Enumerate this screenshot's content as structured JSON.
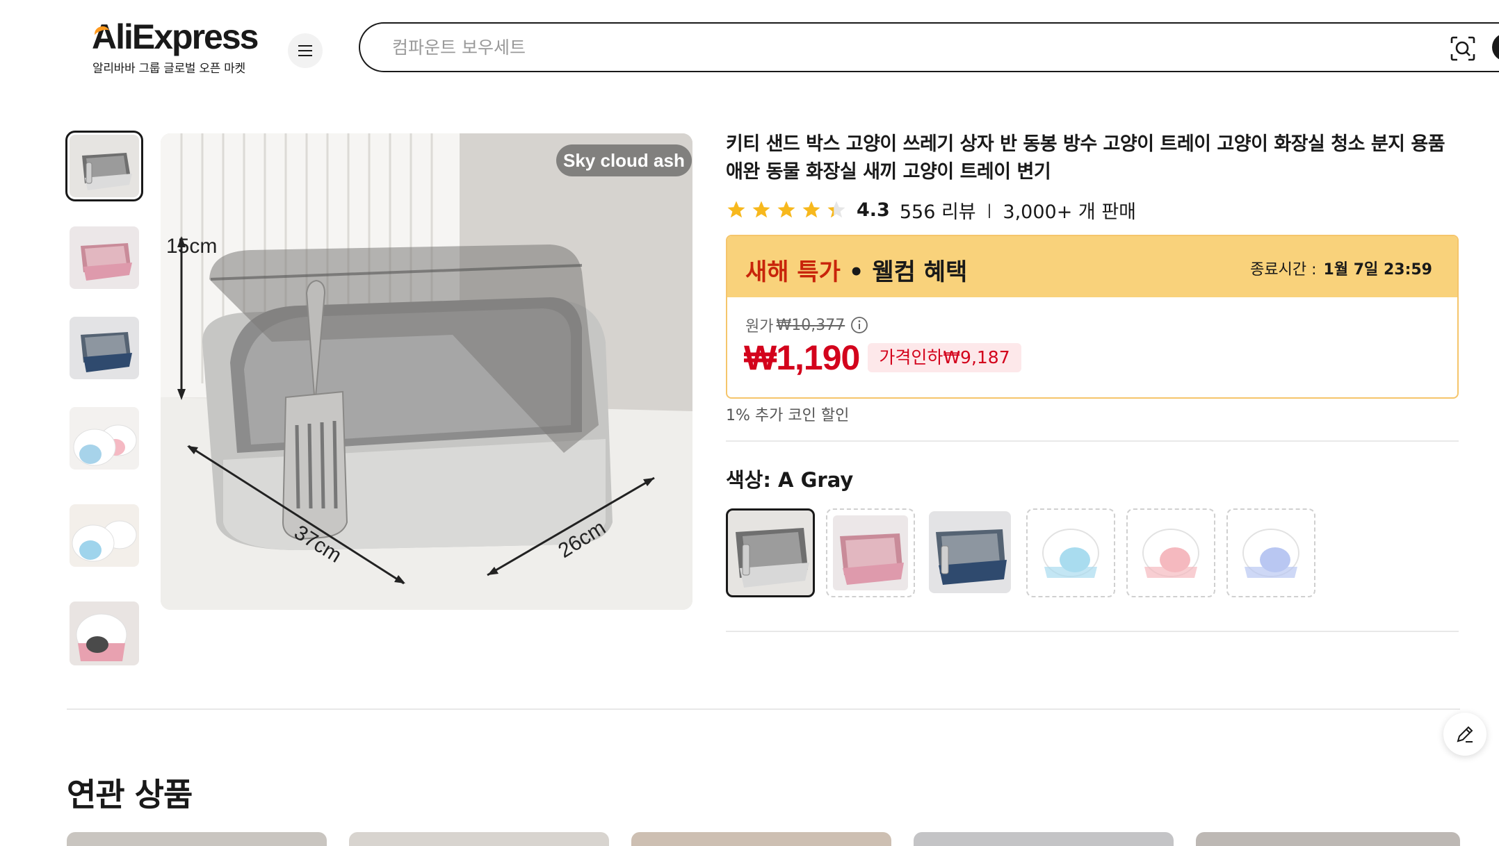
{
  "header": {
    "logo_text": "AliExpress",
    "logo_subtitle": "알리바바 그룹 글로벌 오픈 마켓",
    "search_placeholder": "컴파운트 보우세트"
  },
  "gallery": {
    "variant_tag": "Sky cloud ash",
    "dimension_labels": {
      "height": "15cm",
      "length": "37cm",
      "width": "26cm"
    }
  },
  "product": {
    "title": "키티 샌드 박스 고양이 쓰레기 상자 반 동봉 방수 고양이 트레이 고양이 화장실 청소 분지 용품 애완 동물 화장실 새끼 고양이 트레이 변기",
    "rating": "4.3",
    "rating_value": 4.3,
    "reviews": "556 리뷰",
    "sold": "3,000+ 개 판매"
  },
  "promo": {
    "title_accent": "새해 특가",
    "title_rest": " • 웰컴 혜택",
    "end_label": "종료시간 :",
    "end_time": "1월 7일 23:59",
    "orig_label": "원가",
    "orig_price": "₩10,377",
    "price": "₩1,190",
    "discount": "가격인하₩9,187",
    "coin_note": "1% 추가 코인 할인"
  },
  "colors": {
    "label": "색상: A Gray",
    "selected_index": 0
  },
  "related": {
    "title": "연관 상품"
  },
  "theme": {
    "price_red": "#d3031c",
    "promo_yellow": "#f9d27b",
    "star_gold": "#f7b81d",
    "accent_orange": "#ff9a1f"
  }
}
